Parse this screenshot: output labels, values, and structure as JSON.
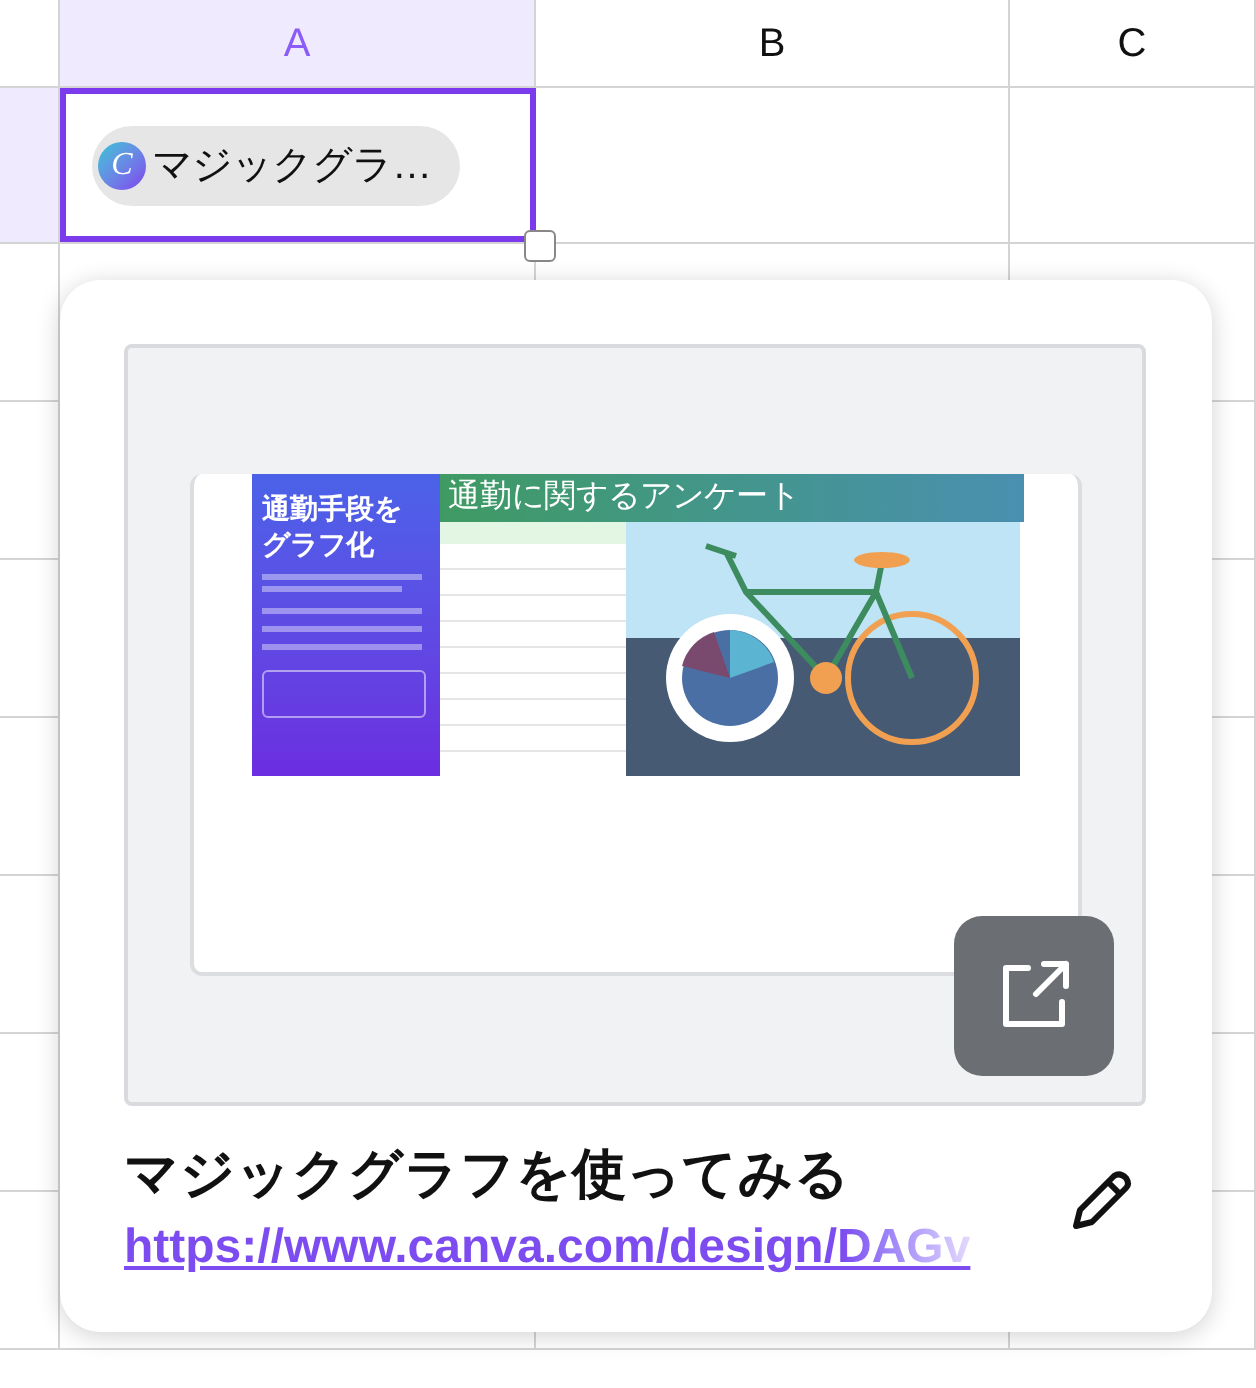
{
  "columns": [
    {
      "label": "A",
      "selected": true
    },
    {
      "label": "B",
      "selected": false
    },
    {
      "label": "C",
      "selected": false
    }
  ],
  "cell": {
    "logo": "C",
    "text": "マジックグラ…"
  },
  "card": {
    "preview": {
      "headline": "通勤手段をグラフ化",
      "banner": "通勤に関するアンケート"
    },
    "title": "マジックグラフを使ってみる",
    "url": "https://www.canva.com/design/DAGv"
  }
}
